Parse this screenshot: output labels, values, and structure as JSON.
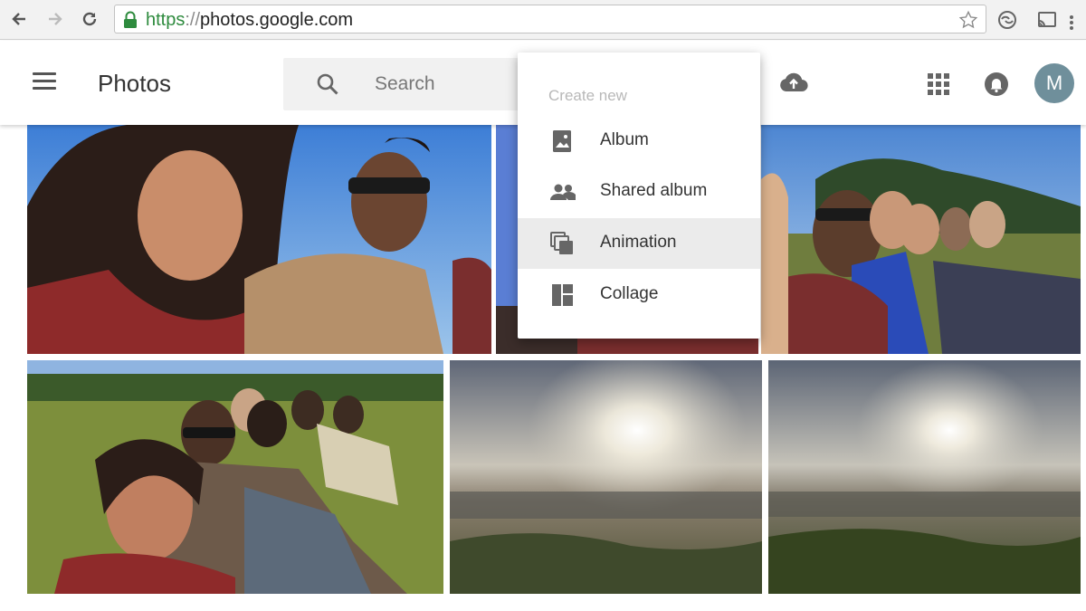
{
  "browser": {
    "url_scheme": "https",
    "url_separator": "://",
    "url_host": "photos.google.com"
  },
  "header": {
    "title": "Photos",
    "search_placeholder": "Search",
    "avatar_initial": "M"
  },
  "create_menu": {
    "heading": "Create new",
    "items": [
      {
        "label": "Album",
        "icon": "album-icon"
      },
      {
        "label": "Shared album",
        "icon": "shared-album-icon"
      },
      {
        "label": "Animation",
        "icon": "animation-icon",
        "highlighted": true
      },
      {
        "label": "Collage",
        "icon": "collage-icon"
      }
    ]
  },
  "colors": {
    "secure_green": "#2e8b3e",
    "avatar_bg": "#6f8f9b",
    "menu_highlight": "#ebebeb"
  }
}
